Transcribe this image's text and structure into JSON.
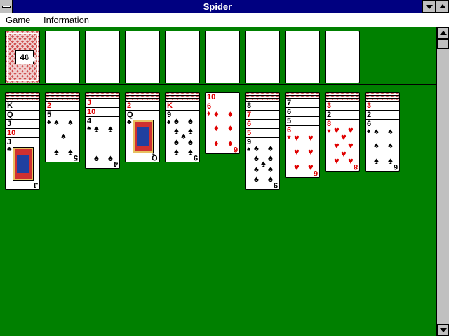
{
  "window": {
    "title": "Spider"
  },
  "menu": {
    "items": [
      "Game",
      "Information"
    ]
  },
  "stock": {
    "count": "40"
  },
  "foundations": 8,
  "tableau": [
    {
      "down": 3,
      "up": [
        [
          "K",
          "♠",
          "b"
        ],
        [
          "Q",
          "♠",
          "b"
        ],
        [
          "J",
          "♠",
          "b"
        ],
        [
          "10",
          "♦",
          "r"
        ],
        [
          "J",
          "♣",
          "b"
        ]
      ]
    },
    {
      "down": 3,
      "up": [
        [
          "2",
          "♦",
          "r"
        ],
        [
          "5",
          "♠",
          "b"
        ]
      ]
    },
    {
      "down": 2,
      "up": [
        [
          "J",
          "♦",
          "r"
        ],
        [
          "10",
          "♦",
          "r"
        ],
        [
          "4",
          "♠",
          "b"
        ]
      ]
    },
    {
      "down": 3,
      "up": [
        [
          "2",
          "♦",
          "r"
        ],
        [
          "Q",
          "♣",
          "b"
        ]
      ]
    },
    {
      "down": 3,
      "up": [
        [
          "K",
          "♦",
          "r"
        ],
        [
          "9",
          "♠",
          "b"
        ]
      ]
    },
    {
      "down": 0,
      "up": [
        [
          "10",
          "♥",
          "r"
        ],
        [
          "6",
          "♦",
          "r"
        ]
      ]
    },
    {
      "down": 3,
      "up": [
        [
          "8",
          "♠",
          "b"
        ],
        [
          "7",
          "♦",
          "r"
        ],
        [
          "6",
          "♥",
          "r"
        ],
        [
          "5",
          "♥",
          "r"
        ],
        [
          "9",
          "♠",
          "b"
        ]
      ]
    },
    {
      "down": 2,
      "up": [
        [
          "7",
          "♣",
          "b"
        ],
        [
          "6",
          "♣",
          "b"
        ],
        [
          "5",
          "♣",
          "b"
        ],
        [
          "6",
          "♥",
          "r"
        ]
      ]
    },
    {
      "down": 3,
      "up": [
        [
          "3",
          "♥",
          "r"
        ],
        [
          "2",
          "♠",
          "b"
        ],
        [
          "8",
          "♥",
          "r"
        ]
      ]
    },
    {
      "down": 3,
      "up": [
        [
          "3",
          "♥",
          "r"
        ],
        [
          "2",
          "♠",
          "b"
        ],
        [
          "6",
          "♠",
          "b"
        ]
      ]
    }
  ]
}
